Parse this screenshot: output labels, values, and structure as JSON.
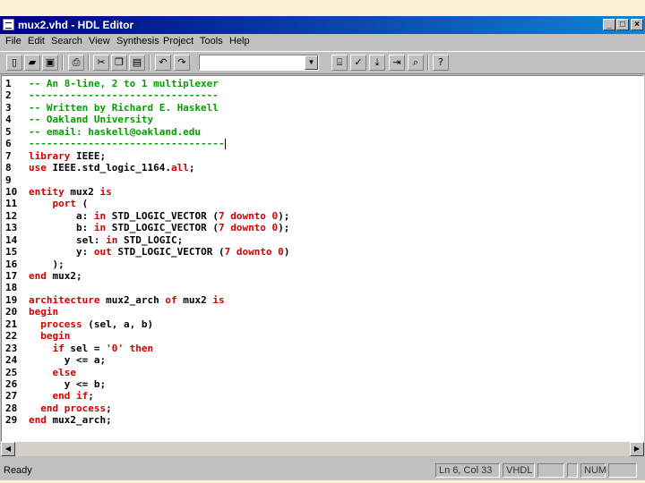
{
  "window": {
    "title": "mux2.vhd - HDL Editor",
    "controls": {
      "minimize": "_",
      "maximize": "□",
      "close": "×"
    }
  },
  "menu": [
    "File",
    "Edit",
    "Search",
    "View",
    "Synthesis",
    "Project",
    "Tools",
    "Help"
  ],
  "toolbar": {
    "buttons": [
      {
        "name": "new-file-icon",
        "glyph": "▯"
      },
      {
        "name": "open-folder-icon",
        "glyph": "▰"
      },
      {
        "name": "save-disk-icon",
        "glyph": "▣"
      },
      {
        "name": "print-icon",
        "glyph": "⎙"
      },
      {
        "name": "cut-icon",
        "glyph": "✂"
      },
      {
        "name": "copy-icon",
        "glyph": "❐"
      },
      {
        "name": "paste-icon",
        "glyph": "▤"
      },
      {
        "name": "undo-icon",
        "glyph": "↶"
      },
      {
        "name": "redo-icon",
        "glyph": "↷"
      },
      {
        "name": "language-assistant-icon",
        "glyph": "⌸"
      },
      {
        "name": "check-syntax-icon",
        "glyph": "✓"
      },
      {
        "name": "download-icon",
        "glyph": "⤓"
      },
      {
        "name": "export-icon",
        "glyph": "⇥"
      },
      {
        "name": "find-icon",
        "glyph": "⌕"
      },
      {
        "name": "help-icon",
        "glyph": "?"
      }
    ],
    "combo_value": ""
  },
  "code": [
    {
      "n": "1",
      "t": [
        {
          "c": "cmt",
          "s": "-- An 8-line, 2 to 1 multiplexer"
        }
      ]
    },
    {
      "n": "2",
      "t": [
        {
          "c": "cmt",
          "s": "--------------------------------"
        }
      ]
    },
    {
      "n": "3",
      "t": [
        {
          "c": "cmt",
          "s": "-- Written by Richard E. Haskell"
        }
      ]
    },
    {
      "n": "4",
      "t": [
        {
          "c": "cmt",
          "s": "-- Oakland University"
        }
      ]
    },
    {
      "n": "5",
      "t": [
        {
          "c": "cmt",
          "s": "-- email: haskell@oakland.edu"
        }
      ]
    },
    {
      "n": "6",
      "t": [
        {
          "c": "cmt",
          "s": "---------------------------------"
        }
      ],
      "cursor": true
    },
    {
      "n": "7",
      "t": [
        {
          "c": "kw",
          "s": "library"
        },
        {
          "c": "id",
          "s": " IEEE;"
        }
      ]
    },
    {
      "n": "8",
      "t": [
        {
          "c": "kw",
          "s": "use"
        },
        {
          "c": "id",
          "s": " IEEE.std_logic_1164."
        },
        {
          "c": "kw",
          "s": "all"
        },
        {
          "c": "id",
          "s": ";"
        }
      ]
    },
    {
      "n": "9",
      "t": []
    },
    {
      "n": "10",
      "t": [
        {
          "c": "kw",
          "s": "entity"
        },
        {
          "c": "id",
          "s": " mux2 "
        },
        {
          "c": "kw",
          "s": "is"
        }
      ]
    },
    {
      "n": "11",
      "t": [
        {
          "c": "id",
          "s": "    "
        },
        {
          "c": "kw",
          "s": "port"
        },
        {
          "c": "id",
          "s": " ("
        }
      ]
    },
    {
      "n": "12",
      "t": [
        {
          "c": "id",
          "s": "        a: "
        },
        {
          "c": "kw",
          "s": "in"
        },
        {
          "c": "id",
          "s": " STD_LOGIC_VECTOR ("
        },
        {
          "c": "kw",
          "s": "7 downto 0"
        },
        {
          "c": "id",
          "s": ");"
        }
      ]
    },
    {
      "n": "13",
      "t": [
        {
          "c": "id",
          "s": "        b: "
        },
        {
          "c": "kw",
          "s": "in"
        },
        {
          "c": "id",
          "s": " STD_LOGIC_VECTOR ("
        },
        {
          "c": "kw",
          "s": "7 downto 0"
        },
        {
          "c": "id",
          "s": ");"
        }
      ]
    },
    {
      "n": "14",
      "t": [
        {
          "c": "id",
          "s": "        sel: "
        },
        {
          "c": "kw",
          "s": "in"
        },
        {
          "c": "id",
          "s": " STD_LOGIC;"
        }
      ]
    },
    {
      "n": "15",
      "t": [
        {
          "c": "id",
          "s": "        y: "
        },
        {
          "c": "kw",
          "s": "out"
        },
        {
          "c": "id",
          "s": " STD_LOGIC_VECTOR ("
        },
        {
          "c": "kw",
          "s": "7 downto 0"
        },
        {
          "c": "id",
          "s": ")"
        }
      ]
    },
    {
      "n": "16",
      "t": [
        {
          "c": "id",
          "s": "    );"
        }
      ]
    },
    {
      "n": "17",
      "t": [
        {
          "c": "kw",
          "s": "end"
        },
        {
          "c": "id",
          "s": " mux2;"
        }
      ]
    },
    {
      "n": "18",
      "t": []
    },
    {
      "n": "19",
      "t": [
        {
          "c": "kw",
          "s": "architecture"
        },
        {
          "c": "id",
          "s": " mux2_arch "
        },
        {
          "c": "kw",
          "s": "of"
        },
        {
          "c": "id",
          "s": " mux2 "
        },
        {
          "c": "kw",
          "s": "is"
        }
      ]
    },
    {
      "n": "20",
      "t": [
        {
          "c": "kw",
          "s": "begin"
        }
      ]
    },
    {
      "n": "21",
      "t": [
        {
          "c": "id",
          "s": "  "
        },
        {
          "c": "kw",
          "s": "process"
        },
        {
          "c": "id",
          "s": " (sel, a, b)"
        }
      ]
    },
    {
      "n": "22",
      "t": [
        {
          "c": "id",
          "s": "  "
        },
        {
          "c": "kw",
          "s": "begin"
        }
      ]
    },
    {
      "n": "23",
      "t": [
        {
          "c": "id",
          "s": "    "
        },
        {
          "c": "kw",
          "s": "if"
        },
        {
          "c": "id",
          "s": " sel = "
        },
        {
          "c": "kw",
          "s": "'0'"
        },
        {
          "c": "id",
          "s": " "
        },
        {
          "c": "kw",
          "s": "then"
        }
      ]
    },
    {
      "n": "24",
      "t": [
        {
          "c": "id",
          "s": "      y <= a;"
        }
      ]
    },
    {
      "n": "25",
      "t": [
        {
          "c": "id",
          "s": "    "
        },
        {
          "c": "kw",
          "s": "else"
        }
      ]
    },
    {
      "n": "26",
      "t": [
        {
          "c": "id",
          "s": "      y <= b;"
        }
      ]
    },
    {
      "n": "27",
      "t": [
        {
          "c": "id",
          "s": "    "
        },
        {
          "c": "kw",
          "s": "end if"
        },
        {
          "c": "id",
          "s": ";"
        }
      ]
    },
    {
      "n": "28",
      "t": [
        {
          "c": "id",
          "s": "  "
        },
        {
          "c": "kw",
          "s": "end process"
        },
        {
          "c": "id",
          "s": ";"
        }
      ]
    },
    {
      "n": "29",
      "t": [
        {
          "c": "kw",
          "s": "end"
        },
        {
          "c": "id",
          "s": " mux2_arch;"
        }
      ]
    }
  ],
  "status": {
    "message": "Ready",
    "position": "Ln 6, Col 33",
    "language": "VHDL",
    "num": "NUM"
  }
}
